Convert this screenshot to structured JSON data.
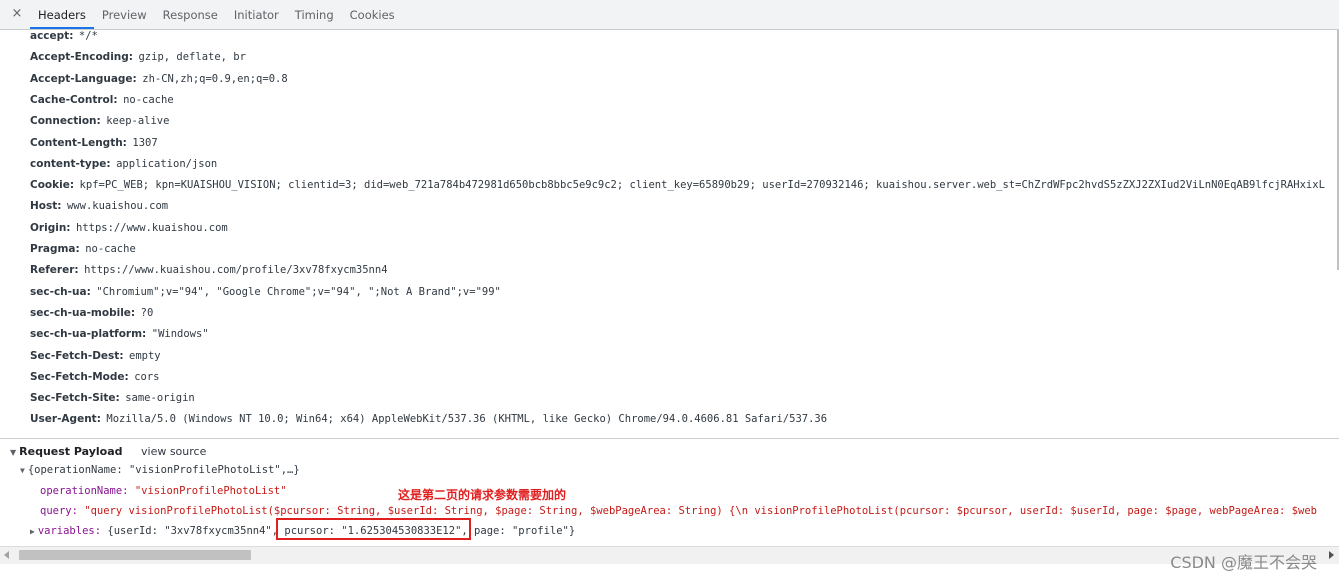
{
  "tabbar": {
    "close_glyph": "×",
    "tabs": [
      {
        "label": "Headers"
      },
      {
        "label": "Preview"
      },
      {
        "label": "Response"
      },
      {
        "label": "Initiator"
      },
      {
        "label": "Timing"
      },
      {
        "label": "Cookies"
      }
    ]
  },
  "headers": [
    {
      "name": "accept:",
      "value": "*/*"
    },
    {
      "name": "Accept-Encoding:",
      "value": "gzip, deflate, br"
    },
    {
      "name": "Accept-Language:",
      "value": "zh-CN,zh;q=0.9,en;q=0.8"
    },
    {
      "name": "Cache-Control:",
      "value": "no-cache"
    },
    {
      "name": "Connection:",
      "value": "keep-alive"
    },
    {
      "name": "Content-Length:",
      "value": "1307"
    },
    {
      "name": "content-type:",
      "value": "application/json"
    },
    {
      "name": "Cookie:",
      "value": "kpf=PC_WEB; kpn=KUAISHOU_VISION; clientid=3; did=web_721a784b472981d650bcb8bbc5e9c9c2; client_key=65890b29; userId=270932146; kuaishou.server.web_st=ChZrdWFpc2hvdS5zZXJ2ZXIud2ViLnN0EqAB9lfcjRAHxixL"
    },
    {
      "name": "Host:",
      "value": "www.kuaishou.com"
    },
    {
      "name": "Origin:",
      "value": "https://www.kuaishou.com"
    },
    {
      "name": "Pragma:",
      "value": "no-cache"
    },
    {
      "name": "Referer:",
      "value": "https://www.kuaishou.com/profile/3xv78fxycm35nn4"
    },
    {
      "name": "sec-ch-ua:",
      "value": "\"Chromium\";v=\"94\", \"Google Chrome\";v=\"94\", \";Not A Brand\";v=\"99\""
    },
    {
      "name": "sec-ch-ua-mobile:",
      "value": "?0"
    },
    {
      "name": "sec-ch-ua-platform:",
      "value": "\"Windows\""
    },
    {
      "name": "Sec-Fetch-Dest:",
      "value": "empty"
    },
    {
      "name": "Sec-Fetch-Mode:",
      "value": "cors"
    },
    {
      "name": "Sec-Fetch-Site:",
      "value": "same-origin"
    },
    {
      "name": "User-Agent:",
      "value": "Mozilla/5.0 (Windows NT 10.0; Win64; x64) AppleWebKit/537.36 (KHTML, like Gecko) Chrome/94.0.4606.81 Safari/537.36"
    }
  ],
  "payload": {
    "title": "Request Payload",
    "view_source": "view source",
    "root": "{operationName: \"visionProfilePhotoList\",…}",
    "op_key": "operationName:",
    "op_val": "\"visionProfilePhotoList\"",
    "query_key": "query:",
    "query_val": "\"query visionProfilePhotoList($pcursor: String, $userId: String, $page: String, $webPageArea: String) {\\n  visionProfilePhotoList(pcursor: $pcursor, userId: $userId, page: $page, webPageArea: $web",
    "vars_key": "variables:",
    "vars_part1": "{userId: \"3xv78fxycm35nn4\"",
    "vars_part2": ", pcursor: \"1.625304530833E12\"",
    "vars_part3": ", page: \"profile\"}"
  },
  "annotation": "这是第二页的请求参数需要加的",
  "watermark": "CSDN @魔王不会哭"
}
